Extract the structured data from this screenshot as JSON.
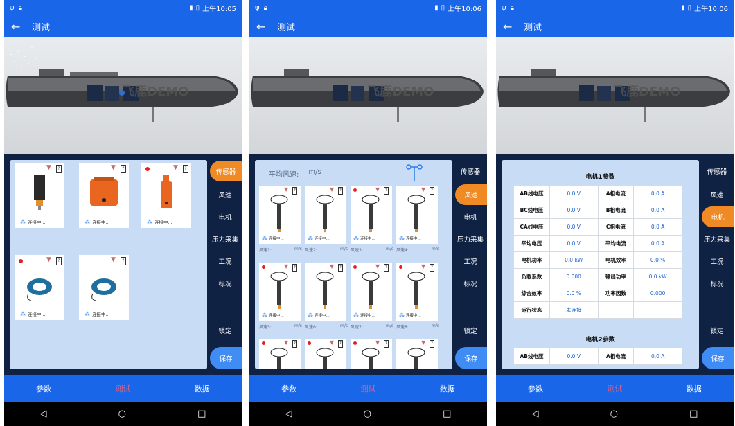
{
  "screens": [
    {
      "status_time": "上午10:05",
      "title": "测试",
      "logo_text": "飞鹿DEMO",
      "nav": [
        "传感器",
        "风速",
        "电机",
        "压力采集",
        "工况",
        "标况",
        "锁定",
        "保存"
      ],
      "active_nav": 0,
      "sensors": [
        {
          "status": "连接中..."
        },
        {
          "status": "连接中..."
        },
        {
          "status": "连接中..."
        },
        {
          "status": "连接中..."
        },
        {
          "status": "连接中..."
        }
      ],
      "tabs": [
        "参数",
        "测试",
        "数据"
      ]
    },
    {
      "status_time": "上午10:06",
      "title": "测试",
      "logo_text": "飞鹿DEMO",
      "avg_wind_label": "平均风速:",
      "avg_wind_unit": "m/s",
      "nav": [
        "传感器",
        "风速",
        "电机",
        "压力采集",
        "工况",
        "标况",
        "锁定",
        "保存"
      ],
      "active_nav": 1,
      "wind_status": "连接中...",
      "wind_labels": [
        "风速1:",
        "风速2:",
        "风速3:",
        "风速4:",
        "风速5:",
        "风速6:",
        "风速7:",
        "风速8:"
      ],
      "wind_unit": "m/s",
      "tabs": [
        "参数",
        "测试",
        "数据"
      ]
    },
    {
      "status_time": "上午10:06",
      "title": "测试",
      "logo_text": "飞鹿DEMO",
      "nav": [
        "传感器",
        "风速",
        "电机",
        "压力采集",
        "工况",
        "标况",
        "锁定",
        "保存"
      ],
      "active_nav": 2,
      "motor1_title": "电机1参数",
      "motor2_title": "电机2参数",
      "motor1_rows": [
        [
          "AB线电压",
          "0.0 V",
          "A相电流",
          "0.0 A"
        ],
        [
          "BC线电压",
          "0.0 V",
          "B相电流",
          "0.0 A"
        ],
        [
          "CA线电压",
          "0.0 V",
          "C相电流",
          "0.0 A"
        ],
        [
          "平均电压",
          "0.0 V",
          "平均电流",
          "0.0 A"
        ],
        [
          "电机功率",
          "0.0 kW",
          "电机效率",
          "0.0 %"
        ],
        [
          "负载系数",
          "0.000",
          "输出功率",
          "0.0 kW"
        ],
        [
          "综合效率",
          "0.0 %",
          "功率因数",
          "0.000"
        ],
        [
          "运行状态",
          "未连接",
          "",
          ""
        ]
      ],
      "motor2_rows": [
        [
          "AB线电压",
          "0.0 V",
          "A相电流",
          "0.0 A"
        ]
      ],
      "tabs": [
        "参数",
        "测试",
        "数据"
      ]
    }
  ],
  "sysnav": [
    "◁",
    "○",
    "□"
  ],
  "colors": {
    "primary": "#1a66e8",
    "accent": "#f08a24",
    "panel": "#0f2244",
    "content": "#c9dcf6",
    "value": "#1d62c8",
    "active_tab": "#f4637a"
  }
}
